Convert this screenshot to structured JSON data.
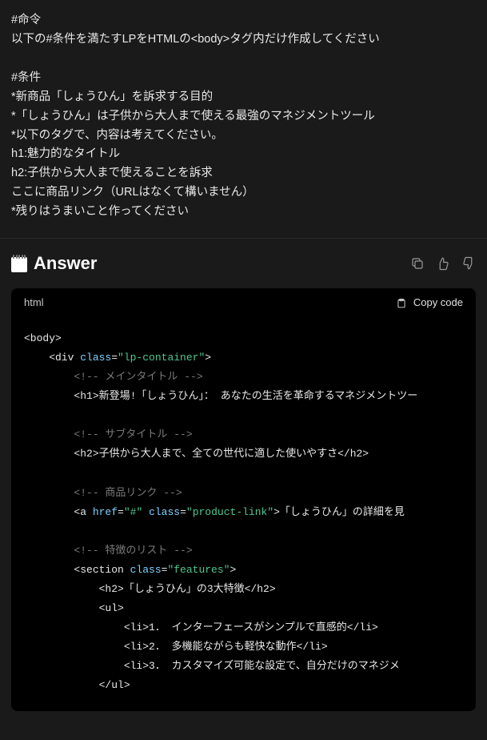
{
  "prompt": {
    "lines": [
      "#命令",
      "以下の#条件を満たすLPをHTMLの<body>タグ内だけ作成してください",
      "",
      "#条件",
      "*新商品「しょうひん」を訴求する目的",
      "*「しょうひん」は子供から大人まで使える最強のマネジメントツール",
      "*以下のタグで、内容は考えてください。",
      "h1:魅力的なタイトル",
      "h2:子供から大人まで使えることを訴求",
      "ここに商品リンク（URLはなくて構いません）",
      "*残りはうまいこと作ってください"
    ]
  },
  "answer": {
    "title": "Answer",
    "language": "html",
    "copy_label": "Copy code"
  },
  "code": {
    "l1_open": "<body>",
    "l2_pre": "    <div ",
    "l2_attr": "class",
    "l2_val": "\"lp-container\"",
    "l2_close": ">",
    "l3_cmt": "        <!-- メインタイトル -->",
    "l4": "        <h1>新登場!「しょうひん」： あなたの生活を革命するマネジメントツー",
    "l5_cmt": "        <!-- サブタイトル -->",
    "l6": "        <h2>子供から大人まで、全ての世代に適した使いやすさ</h2>",
    "l7_cmt": "        <!-- 商品リンク -->",
    "l8_pre": "        <a ",
    "l8_attr1": "href",
    "l8_val1": "\"#\"",
    "l8_sp": " ",
    "l8_attr2": "class",
    "l8_val2": "\"product-link\"",
    "l8_post": ">「しょうひん」の詳細を見",
    "l9_cmt": "        <!-- 特徴のリスト -->",
    "l10_pre": "        <section ",
    "l10_attr": "class",
    "l10_val": "\"features\"",
    "l10_close": ">",
    "l11": "            <h2>「しょうひん」の3大特徴</h2>",
    "l12": "            <ul>",
    "l13": "                <li>1． インターフェースがシンプルで直感的</li>",
    "l14": "                <li>2． 多機能ながらも軽快な動作</li>",
    "l15": "                <li>3． カスタマイズ可能な設定で、自分だけのマネジメ",
    "l16": "            </ul>"
  }
}
